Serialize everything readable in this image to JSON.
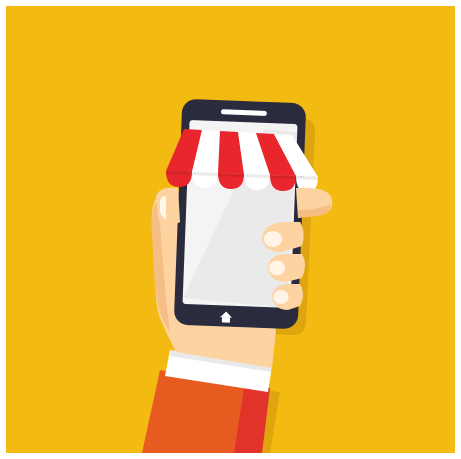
{
  "illustration": {
    "subject": "hand-holding-smartphone-with-shop-awning",
    "colors": {
      "background": "#F3BB12",
      "shadow": "#DFA50E",
      "phone_body": "#2B2B3E",
      "screen": "#F4F4F4",
      "awning_red": "#E8262B",
      "awning_white": "#FFFFFF",
      "skin": "#FDD3A2",
      "skin_shade": "#F5BE84",
      "nail": "#FFF4E6",
      "cuff": "#FFFFFF",
      "sleeve": "#E85B20",
      "sleeve_dark": "#E2332B"
    },
    "icons": {
      "speaker": "speaker-slot-icon",
      "home_button": "home-icon"
    }
  }
}
